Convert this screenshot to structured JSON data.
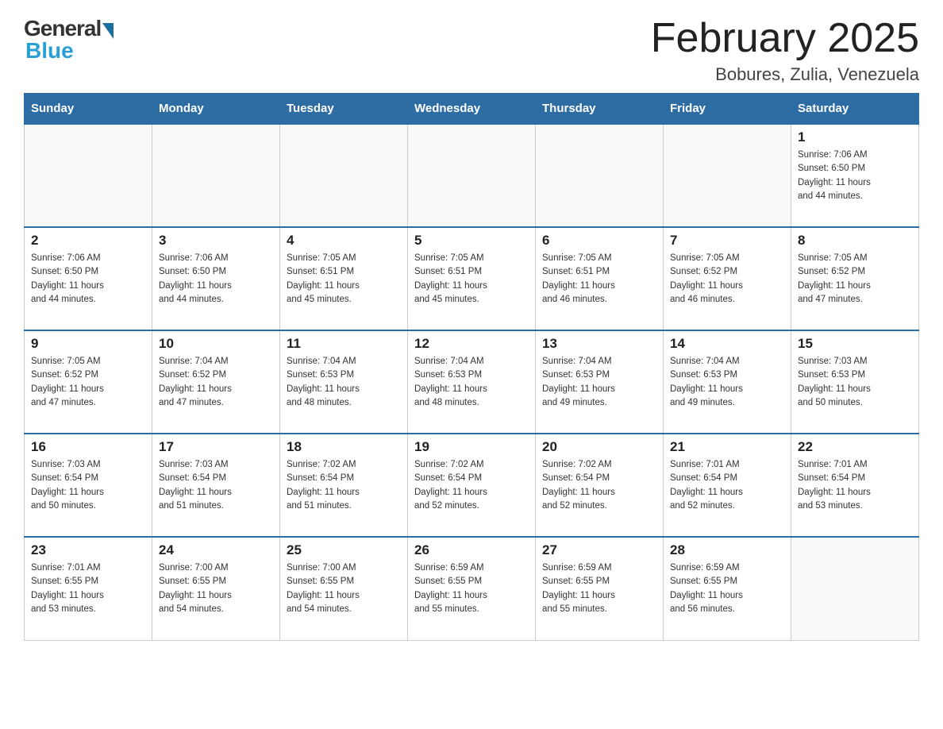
{
  "logo": {
    "general": "General",
    "blue": "Blue"
  },
  "header": {
    "title": "February 2025",
    "subtitle": "Bobures, Zulia, Venezuela"
  },
  "weekdays": [
    "Sunday",
    "Monday",
    "Tuesday",
    "Wednesday",
    "Thursday",
    "Friday",
    "Saturday"
  ],
  "weeks": [
    [
      {
        "day": "",
        "info": ""
      },
      {
        "day": "",
        "info": ""
      },
      {
        "day": "",
        "info": ""
      },
      {
        "day": "",
        "info": ""
      },
      {
        "day": "",
        "info": ""
      },
      {
        "day": "",
        "info": ""
      },
      {
        "day": "1",
        "info": "Sunrise: 7:06 AM\nSunset: 6:50 PM\nDaylight: 11 hours\nand 44 minutes."
      }
    ],
    [
      {
        "day": "2",
        "info": "Sunrise: 7:06 AM\nSunset: 6:50 PM\nDaylight: 11 hours\nand 44 minutes."
      },
      {
        "day": "3",
        "info": "Sunrise: 7:06 AM\nSunset: 6:50 PM\nDaylight: 11 hours\nand 44 minutes."
      },
      {
        "day": "4",
        "info": "Sunrise: 7:05 AM\nSunset: 6:51 PM\nDaylight: 11 hours\nand 45 minutes."
      },
      {
        "day": "5",
        "info": "Sunrise: 7:05 AM\nSunset: 6:51 PM\nDaylight: 11 hours\nand 45 minutes."
      },
      {
        "day": "6",
        "info": "Sunrise: 7:05 AM\nSunset: 6:51 PM\nDaylight: 11 hours\nand 46 minutes."
      },
      {
        "day": "7",
        "info": "Sunrise: 7:05 AM\nSunset: 6:52 PM\nDaylight: 11 hours\nand 46 minutes."
      },
      {
        "day": "8",
        "info": "Sunrise: 7:05 AM\nSunset: 6:52 PM\nDaylight: 11 hours\nand 47 minutes."
      }
    ],
    [
      {
        "day": "9",
        "info": "Sunrise: 7:05 AM\nSunset: 6:52 PM\nDaylight: 11 hours\nand 47 minutes."
      },
      {
        "day": "10",
        "info": "Sunrise: 7:04 AM\nSunset: 6:52 PM\nDaylight: 11 hours\nand 47 minutes."
      },
      {
        "day": "11",
        "info": "Sunrise: 7:04 AM\nSunset: 6:53 PM\nDaylight: 11 hours\nand 48 minutes."
      },
      {
        "day": "12",
        "info": "Sunrise: 7:04 AM\nSunset: 6:53 PM\nDaylight: 11 hours\nand 48 minutes."
      },
      {
        "day": "13",
        "info": "Sunrise: 7:04 AM\nSunset: 6:53 PM\nDaylight: 11 hours\nand 49 minutes."
      },
      {
        "day": "14",
        "info": "Sunrise: 7:04 AM\nSunset: 6:53 PM\nDaylight: 11 hours\nand 49 minutes."
      },
      {
        "day": "15",
        "info": "Sunrise: 7:03 AM\nSunset: 6:53 PM\nDaylight: 11 hours\nand 50 minutes."
      }
    ],
    [
      {
        "day": "16",
        "info": "Sunrise: 7:03 AM\nSunset: 6:54 PM\nDaylight: 11 hours\nand 50 minutes."
      },
      {
        "day": "17",
        "info": "Sunrise: 7:03 AM\nSunset: 6:54 PM\nDaylight: 11 hours\nand 51 minutes."
      },
      {
        "day": "18",
        "info": "Sunrise: 7:02 AM\nSunset: 6:54 PM\nDaylight: 11 hours\nand 51 minutes."
      },
      {
        "day": "19",
        "info": "Sunrise: 7:02 AM\nSunset: 6:54 PM\nDaylight: 11 hours\nand 52 minutes."
      },
      {
        "day": "20",
        "info": "Sunrise: 7:02 AM\nSunset: 6:54 PM\nDaylight: 11 hours\nand 52 minutes."
      },
      {
        "day": "21",
        "info": "Sunrise: 7:01 AM\nSunset: 6:54 PM\nDaylight: 11 hours\nand 52 minutes."
      },
      {
        "day": "22",
        "info": "Sunrise: 7:01 AM\nSunset: 6:54 PM\nDaylight: 11 hours\nand 53 minutes."
      }
    ],
    [
      {
        "day": "23",
        "info": "Sunrise: 7:01 AM\nSunset: 6:55 PM\nDaylight: 11 hours\nand 53 minutes."
      },
      {
        "day": "24",
        "info": "Sunrise: 7:00 AM\nSunset: 6:55 PM\nDaylight: 11 hours\nand 54 minutes."
      },
      {
        "day": "25",
        "info": "Sunrise: 7:00 AM\nSunset: 6:55 PM\nDaylight: 11 hours\nand 54 minutes."
      },
      {
        "day": "26",
        "info": "Sunrise: 6:59 AM\nSunset: 6:55 PM\nDaylight: 11 hours\nand 55 minutes."
      },
      {
        "day": "27",
        "info": "Sunrise: 6:59 AM\nSunset: 6:55 PM\nDaylight: 11 hours\nand 55 minutes."
      },
      {
        "day": "28",
        "info": "Sunrise: 6:59 AM\nSunset: 6:55 PM\nDaylight: 11 hours\nand 56 minutes."
      },
      {
        "day": "",
        "info": ""
      }
    ]
  ]
}
